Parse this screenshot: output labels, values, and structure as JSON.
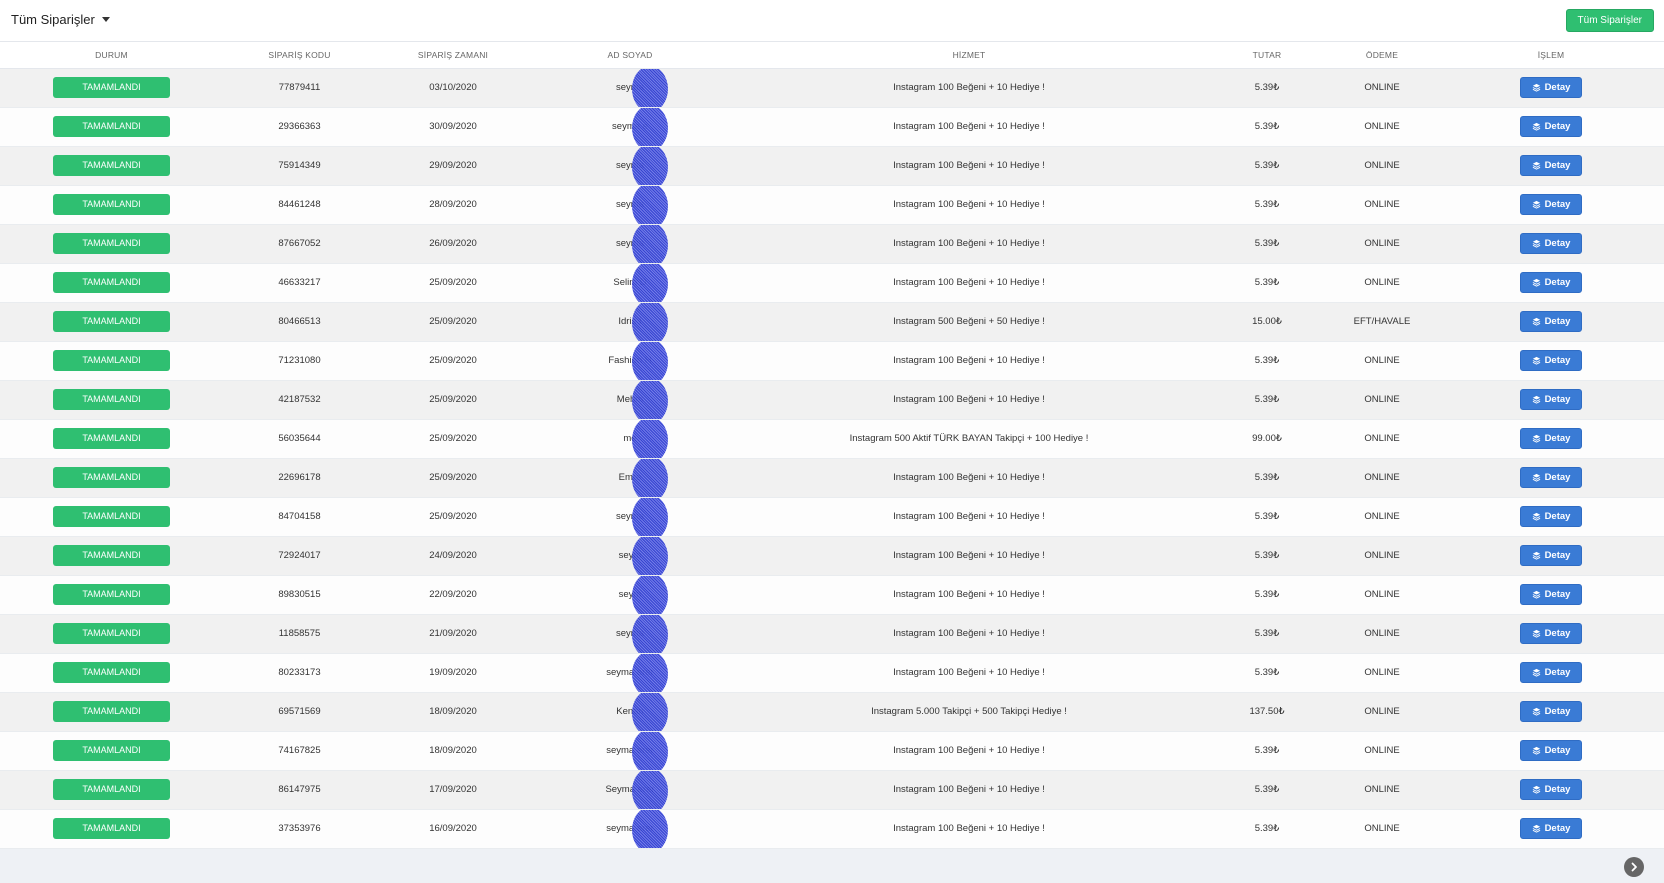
{
  "header": {
    "filter_label": "Tüm Siparişler",
    "all_orders_button": "Tüm Siparişler"
  },
  "table": {
    "columns": [
      "DURUM",
      "SİPARİŞ KODU",
      "SİPARİŞ ZAMANI",
      "AD SOYAD",
      "HİZMET",
      "TUTAR",
      "ÖDEME",
      "İŞLEM"
    ],
    "detail_label": "Detay",
    "rows": [
      {
        "status": "TAMAMLANDI",
        "code": "77879411",
        "date": "03/10/2020",
        "name": "seyma",
        "service": "Instagram 100 Beğeni + 10 Hediye !",
        "amount": "5.39₺",
        "payment": "ONLINE"
      },
      {
        "status": "TAMAMLANDI",
        "code": "29366363",
        "date": "30/09/2020",
        "name": "seyma e",
        "service": "Instagram 100 Beğeni + 10 Hediye !",
        "amount": "5.39₺",
        "payment": "ONLINE"
      },
      {
        "status": "TAMAMLANDI",
        "code": "75914349",
        "date": "29/09/2020",
        "name": "seyma",
        "service": "Instagram 100 Beğeni + 10 Hediye !",
        "amount": "5.39₺",
        "payment": "ONLINE"
      },
      {
        "status": "TAMAMLANDI",
        "code": "84461248",
        "date": "28/09/2020",
        "name": "seyma",
        "service": "Instagram 100 Beğeni + 10 Hediye !",
        "amount": "5.39₺",
        "payment": "ONLINE"
      },
      {
        "status": "TAMAMLANDI",
        "code": "87667052",
        "date": "26/09/2020",
        "name": "seyma",
        "service": "Instagram 100 Beğeni + 10 Hediye !",
        "amount": "5.39₺",
        "payment": "ONLINE"
      },
      {
        "status": "TAMAMLANDI",
        "code": "46633217",
        "date": "25/09/2020",
        "name": "Selim D",
        "service": "Instagram 100 Beğeni + 10 Hediye !",
        "amount": "5.39₺",
        "payment": "ONLINE"
      },
      {
        "status": "TAMAMLANDI",
        "code": "80466513",
        "date": "25/09/2020",
        "name": "Idris I",
        "service": "Instagram 500 Beğeni + 50 Hediye !",
        "amount": "15.00₺",
        "payment": "EFT/HAVALE"
      },
      {
        "status": "TAMAMLANDI",
        "code": "71231080",
        "date": "25/09/2020",
        "name": "Fashion H",
        "service": "Instagram 100 Beğeni + 10 Hediye !",
        "amount": "5.39₺",
        "payment": "ONLINE"
      },
      {
        "status": "TAMAMLANDI",
        "code": "42187532",
        "date": "25/09/2020",
        "name": "Mehm",
        "service": "Instagram 100 Beğeni + 10 Hediye !",
        "amount": "5.39₺",
        "payment": "ONLINE"
      },
      {
        "status": "TAMAMLANDI",
        "code": "56035644",
        "date": "25/09/2020",
        "name": "me",
        "service": "Instagram 500 Aktif TÜRK BAYAN Takipçi + 100 Hediye !",
        "amount": "99.00₺",
        "payment": "ONLINE"
      },
      {
        "status": "TAMAMLANDI",
        "code": "22696178",
        "date": "25/09/2020",
        "name": "Emre",
        "service": "Instagram 100 Beğeni + 10 Hediye !",
        "amount": "5.39₺",
        "payment": "ONLINE"
      },
      {
        "status": "TAMAMLANDI",
        "code": "84704158",
        "date": "25/09/2020",
        "name": "seyma",
        "service": "Instagram 100 Beğeni + 10 Hediye !",
        "amount": "5.39₺",
        "payment": "ONLINE"
      },
      {
        "status": "TAMAMLANDI",
        "code": "72924017",
        "date": "24/09/2020",
        "name": "seym",
        "service": "Instagram 100 Beğeni + 10 Hediye !",
        "amount": "5.39₺",
        "payment": "ONLINE"
      },
      {
        "status": "TAMAMLANDI",
        "code": "89830515",
        "date": "22/09/2020",
        "name": "seym",
        "service": "Instagram 100 Beğeni + 10 Hediye !",
        "amount": "5.39₺",
        "payment": "ONLINE"
      },
      {
        "status": "TAMAMLANDI",
        "code": "11858575",
        "date": "21/09/2020",
        "name": "seyma",
        "service": "Instagram 100 Beğeni + 10 Hediye !",
        "amount": "5.39₺",
        "payment": "ONLINE"
      },
      {
        "status": "TAMAMLANDI",
        "code": "80233173",
        "date": "19/09/2020",
        "name": "seyma erer",
        "service": "Instagram 100 Beğeni + 10 Hediye !",
        "amount": "5.39₺",
        "payment": "ONLINE"
      },
      {
        "status": "TAMAMLANDI",
        "code": "69571569",
        "date": "18/09/2020",
        "name": "Kenan",
        "service": "Instagram 5.000 Takipçi + 500 Takipçi Hediye !",
        "amount": "137.50₺",
        "payment": "ONLINE"
      },
      {
        "status": "TAMAMLANDI",
        "code": "74167825",
        "date": "18/09/2020",
        "name": "seyma erer",
        "service": "Instagram 100 Beğeni + 10 Hediye !",
        "amount": "5.39₺",
        "payment": "ONLINE"
      },
      {
        "status": "TAMAMLANDI",
        "code": "86147975",
        "date": "17/09/2020",
        "name": "Seyma erer",
        "service": "Instagram 100 Beğeni + 10 Hediye !",
        "amount": "5.39₺",
        "payment": "ONLINE"
      },
      {
        "status": "TAMAMLANDI",
        "code": "37353976",
        "date": "16/09/2020",
        "name": "seyma erer",
        "service": "Instagram 100 Beğeni + 10 Hediye !",
        "amount": "5.39₺",
        "payment": "ONLINE"
      }
    ]
  },
  "colors": {
    "status_green": "#2fbf71",
    "detail_blue": "#3a7bd5",
    "redaction_blue": "#2c3bcf"
  },
  "icons": {
    "detail_icon": "layers-icon",
    "next_icon": "chevron-right-icon"
  }
}
